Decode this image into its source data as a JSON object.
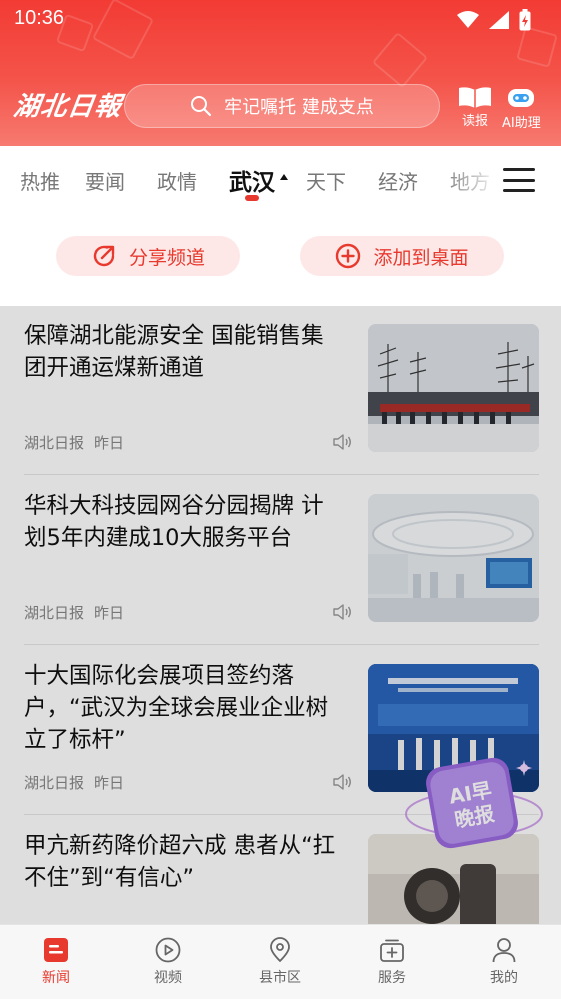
{
  "status_bar": {
    "time": "10:36"
  },
  "header": {
    "logo_text": "湖北日報",
    "search_placeholder": "牢记嘱托 建成支点",
    "read_label": "读报",
    "ai_label": "AI助理"
  },
  "tabs": [
    {
      "label": "热推"
    },
    {
      "label": "要闻"
    },
    {
      "label": "政情"
    },
    {
      "label": "武汉",
      "active": true
    },
    {
      "label": "天下"
    },
    {
      "label": "经济"
    },
    {
      "label": "地方"
    }
  ],
  "channel_actions": {
    "share_label": "分享频道",
    "add_label": "添加到桌面"
  },
  "news": [
    {
      "title": "保障湖北能源安全 国能销售集团开通运煤新通道",
      "source": "湖北日报",
      "time": "昨日"
    },
    {
      "title": "华科大科技园网谷分园揭牌 计划5年内建成10大服务平台",
      "source": "湖北日报",
      "time": "昨日"
    },
    {
      "title": "十大国际化会展项目签约落户，“武汉为全球会展业企业树立了标杆”",
      "source": "湖北日报",
      "time": "昨日"
    },
    {
      "title": "甲亢新药降价超六成  患者从“扛不住”到“有信心”",
      "source": "",
      "time": ""
    }
  ],
  "ai_badge_text": "AI早晚报",
  "bottom_nav": [
    {
      "label": "新闻",
      "icon": "news-icon",
      "active": true
    },
    {
      "label": "视频",
      "icon": "video-icon"
    },
    {
      "label": "县市区",
      "icon": "location-icon"
    },
    {
      "label": "服务",
      "icon": "service-icon"
    },
    {
      "label": "我的",
      "icon": "profile-icon"
    }
  ],
  "colors": {
    "accent": "#e8392e",
    "header": "#f23b34",
    "pill_bg": "#fde8e7"
  }
}
